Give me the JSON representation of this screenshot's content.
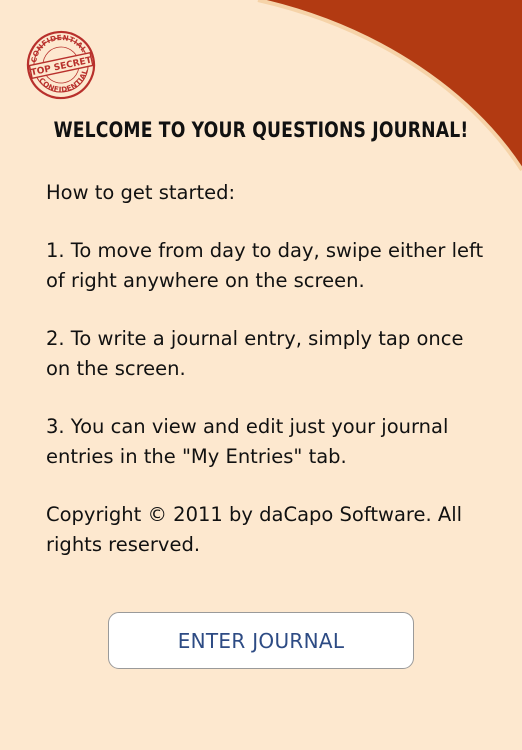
{
  "seal": {
    "text_top": "CONFIDENTIAL",
    "text_center": "TOP SECRET",
    "text_bottom": "CONFIDENTIAL"
  },
  "header": {
    "title": "WELCOME TO YOUR QUESTIONS JOURNAL!"
  },
  "instructions": {
    "intro": "How to get started:",
    "step1": "1. To move from day to day, swipe either left of right anywhere on the screen.",
    "step2": "2. To write a journal entry, simply tap once on the screen.",
    "step3": "3. You can view and edit just your journal entries in the \"My Entries\" tab.",
    "copyright": "Copyright © 2011 by daCapo Software. All rights reserved."
  },
  "actions": {
    "enter_label": "ENTER JOURNAL"
  },
  "colors": {
    "background": "#fde8cf",
    "accent_curve": "#b23a12",
    "button_text": "#2d4b84",
    "seal": "#b8302c"
  }
}
